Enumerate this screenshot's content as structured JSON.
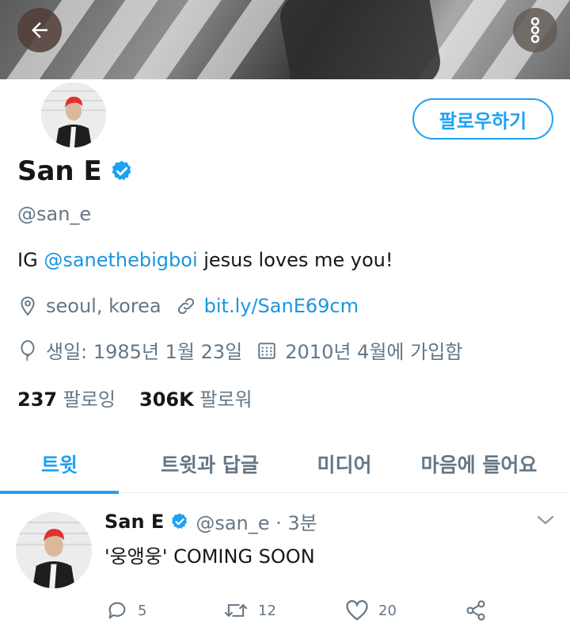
{
  "profile": {
    "display_name": "San E",
    "handle": "@san_e",
    "follow_label": "팔로우하기",
    "bio_prefix": "IG ",
    "bio_mention": "@sanethebigboi",
    "bio_suffix": " jesus loves me you!",
    "location": "seoul, korea",
    "website": "bit.ly/SanE69cm",
    "birthday": "생일: 1985년 1월 23일",
    "joined": "2010년 4월에 가입함",
    "following_count": "237",
    "following_label": "팔로잉",
    "followers_count": "306K",
    "followers_label": "팔로워"
  },
  "tabs": [
    {
      "label": "트윗"
    },
    {
      "label": "트윗과 답글"
    },
    {
      "label": "미디어"
    },
    {
      "label": "마음에 들어요"
    }
  ],
  "tweet": {
    "name": "San E",
    "handle_time": "@san_e · 3분",
    "text": "'웅앵웅' COMING SOON",
    "replies": "5",
    "retweets": "12",
    "likes": "20"
  },
  "colors": {
    "accent": "#1da1f2",
    "link": "#1b95e0",
    "muted": "#657786",
    "text": "#14171a"
  },
  "icons": [
    "back-arrow-icon",
    "more-vertical-icon",
    "verified-badge-icon",
    "location-pin-icon",
    "link-icon",
    "balloon-icon",
    "calendar-icon",
    "chevron-down-icon",
    "reply-icon",
    "retweet-icon",
    "heart-icon",
    "share-icon"
  ]
}
